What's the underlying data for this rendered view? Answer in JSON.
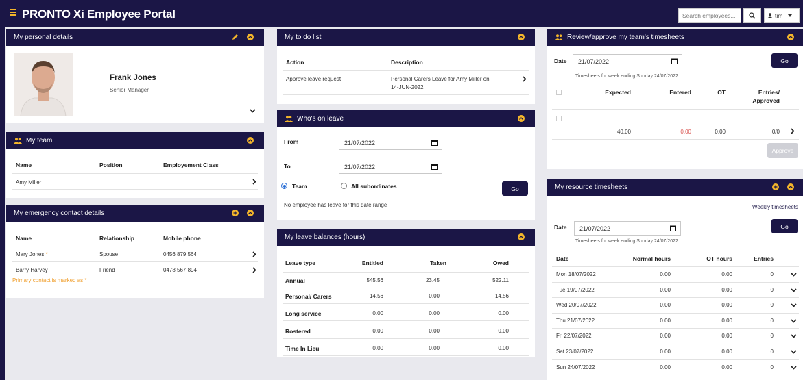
{
  "header": {
    "brand": "PRONTO Xi Employee Portal",
    "search_placeholder": "Search employees...",
    "user": "tim"
  },
  "personal": {
    "title": "My personal details",
    "name": "Frank Jones",
    "role": "Senior Manager"
  },
  "team": {
    "title": "My team",
    "columns": [
      "Name",
      "Position",
      "Employement Class"
    ],
    "rows": [
      {
        "name": "Amy Miller"
      }
    ]
  },
  "emergency": {
    "title": "My emergency contact details",
    "columns": [
      "Name",
      "Relationship",
      "Mobile phone"
    ],
    "rows": [
      {
        "name": "Mary Jones",
        "star": "*",
        "relationship": "Spouse",
        "phone": "0456 879 564"
      },
      {
        "name": "Barry Harvey",
        "star": "",
        "relationship": "Friend",
        "phone": "0478 567 894"
      }
    ],
    "note": "Primary contact is marked as *"
  },
  "todo": {
    "title": "My to do list",
    "columns": [
      "Action",
      "Description"
    ],
    "rows": [
      {
        "action": "Approve leave request",
        "description_line1": "Personal Carers Leave for Amy Miller on",
        "description_line2": "14-JUN-2022"
      }
    ]
  },
  "leave": {
    "title": "Who's on leave",
    "from_label": "From",
    "from_value": "21/07/2022",
    "to_label": "To",
    "to_value": "21/07/2022",
    "team_label": "Team",
    "subs_label": "All subordinates",
    "go": "Go",
    "message": "No employee has leave for this date range"
  },
  "balances": {
    "title": "My leave balances (hours)",
    "columns": [
      "Leave type",
      "Entitled",
      "Taken",
      "Owed"
    ],
    "rows": [
      {
        "type": "Annual",
        "entitled": "545.56",
        "taken": "23.45",
        "owed": "522.11"
      },
      {
        "type": "Personal/ Carers",
        "entitled": "14.56",
        "taken": "0.00",
        "owed": "14.56"
      },
      {
        "type": "Long service",
        "entitled": "0.00",
        "taken": "0.00",
        "owed": "0.00"
      },
      {
        "type": "Rostered",
        "entitled": "0.00",
        "taken": "0.00",
        "owed": "0.00"
      },
      {
        "type": "Time In Lieu",
        "entitled": "0.00",
        "taken": "0.00",
        "owed": "0.00"
      }
    ]
  },
  "review": {
    "title": "Review/approve my team's timesheets",
    "date_label": "Date",
    "date_value": "21/07/2022",
    "go": "Go",
    "week_note": "Timesheets for week ending Sunday 24/07/2022",
    "columns": [
      "Expected",
      "Entered",
      "OT",
      "Entries/",
      "Approved"
    ],
    "row": {
      "expected": "40.00",
      "entered": "0.00",
      "ot": "0.00",
      "entries": "0/0"
    },
    "approve": "Approve",
    "entered_color": "#d9534f"
  },
  "resource": {
    "title": "My resource timesheets",
    "weekly_link": "Weekly timesheets",
    "date_label": "Date",
    "date_value": "21/07/2022",
    "go": "Go",
    "week_note": "Timesheets for week ending Sunday 24/07/2022",
    "columns": [
      "Date",
      "Normal hours",
      "OT hours",
      "Entries"
    ],
    "rows": [
      {
        "date": "Mon 18/07/2022",
        "normal": "0.00",
        "ot": "0.00",
        "entries": "0"
      },
      {
        "date": "Tue 19/07/2022",
        "normal": "0.00",
        "ot": "0.00",
        "entries": "0"
      },
      {
        "date": "Wed 20/07/2022",
        "normal": "0.00",
        "ot": "0.00",
        "entries": "0"
      },
      {
        "date": "Thu 21/07/2022",
        "normal": "0.00",
        "ot": "0.00",
        "entries": "0"
      },
      {
        "date": "Fri 22/07/2022",
        "normal": "0.00",
        "ot": "0.00",
        "entries": "0"
      },
      {
        "date": "Sat 23/07/2022",
        "normal": "0.00",
        "ot": "0.00",
        "entries": "0"
      },
      {
        "date": "Sun 24/07/2022",
        "normal": "0.00",
        "ot": "0.00",
        "entries": "0"
      }
    ]
  },
  "colors": {
    "navy": "#1b1646",
    "accent": "#f3b52b",
    "note": "#f0a030"
  }
}
